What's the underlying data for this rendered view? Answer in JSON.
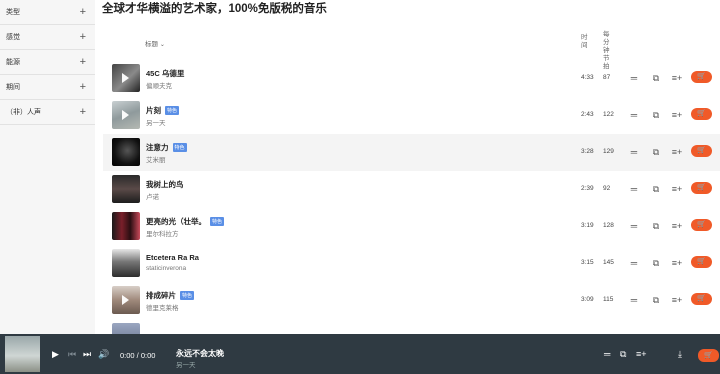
{
  "sidebar": {
    "items": [
      {
        "label": "类型"
      },
      {
        "label": "感觉"
      },
      {
        "label": "能源"
      },
      {
        "label": "期间"
      },
      {
        "label": "（非）人声"
      }
    ],
    "plus_glyph": "+"
  },
  "header": {
    "title": "全球才华横溢的艺术家，100%免版税的音乐"
  },
  "columns": {
    "title": "标题",
    "duration": "时间",
    "bpm": "每分钟节拍"
  },
  "tracks": [
    {
      "title": "45C 乌德里",
      "artist": "偏顺夫克",
      "badge": "",
      "duration": "4:33",
      "bpm": "87"
    },
    {
      "title": "片刻",
      "artist": "另一天",
      "badge": "特色",
      "duration": "2:43",
      "bpm": "122"
    },
    {
      "title": "注意力",
      "artist": "艾米丽",
      "badge": "特色",
      "duration": "3:28",
      "bpm": "129"
    },
    {
      "title": "我树上的鸟",
      "artist": "卢诺",
      "badge": "",
      "duration": "2:39",
      "bpm": "92"
    },
    {
      "title": "更亮的光（壮举。",
      "artist": "里尔科拉方",
      "badge": "特色",
      "duration": "3:19",
      "bpm": "128"
    },
    {
      "title": "Etcetera Ra Ra",
      "artist": "staticinverona",
      "badge": "",
      "duration": "3:15",
      "bpm": "145"
    },
    {
      "title": "排成碎片",
      "artist": "德里克莱格",
      "badge": "特色",
      "duration": "3:09",
      "bpm": "115"
    }
  ],
  "player": {
    "time": "0:00 / 0:00",
    "title": "永远不会太晚",
    "artist": "另一天"
  },
  "colors": {
    "accent": "#f05a28",
    "badge": "#5a8fe6",
    "player_bg": "#2f3a42"
  },
  "icons": [
    "plus-icon",
    "chevron-down-icon",
    "play-icon",
    "equalizer-icon",
    "copy-icon",
    "add-to-playlist-icon",
    "cart-icon",
    "previous-icon",
    "next-icon",
    "volume-icon",
    "download-icon"
  ]
}
